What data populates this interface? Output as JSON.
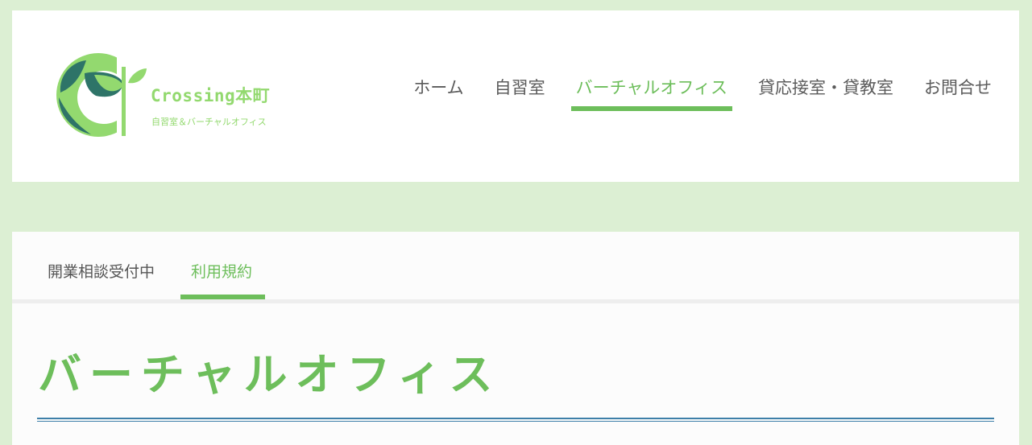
{
  "colors": {
    "background": "#dcefd3",
    "accent": "#6dbe5b",
    "logo_green": "#93d96f",
    "logo_dark": "#2e7468",
    "text": "#5b5b5b",
    "rule": "#3d7fa8"
  },
  "logo": {
    "icon": "leaf-c-logo-icon",
    "name": "Crossing本町",
    "subtitle": "自習室＆バーチャルオフィス"
  },
  "nav": {
    "items": [
      {
        "label": "ホーム",
        "active": false
      },
      {
        "label": "自習室",
        "active": false
      },
      {
        "label": "バーチャルオフィス",
        "active": true
      },
      {
        "label": "貸応接室・貸教室",
        "active": false
      },
      {
        "label": "お問合せ",
        "active": false
      }
    ]
  },
  "tabs": [
    {
      "label": "開業相談受付中",
      "active": false
    },
    {
      "label": "利用規約",
      "active": true
    }
  ],
  "page": {
    "title": "バーチャルオフィス"
  }
}
